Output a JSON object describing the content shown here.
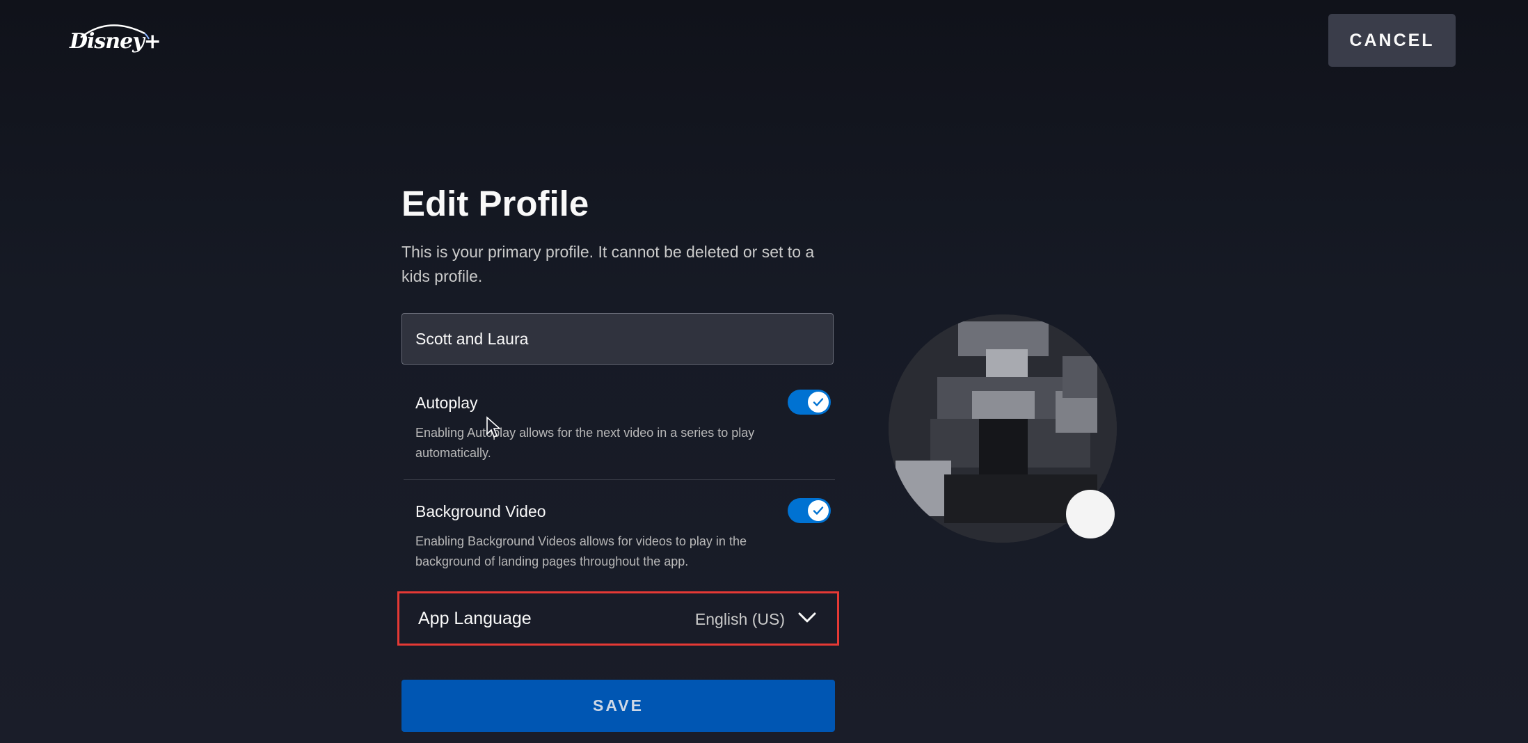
{
  "header": {
    "logo_text": "Disney+",
    "cancel_label": "CANCEL"
  },
  "page": {
    "title": "Edit Profile",
    "subtitle": "This is your primary profile. It cannot be deleted or set to a kids profile."
  },
  "profile_name": {
    "value": "Scott and Laura"
  },
  "settings": {
    "autoplay": {
      "label": "Autoplay",
      "description": "Enabling Autoplay allows for the next video in a series to play automatically.",
      "enabled": true
    },
    "background_video": {
      "label": "Background Video",
      "description": "Enabling Background Videos allows for videos to play in the background of landing pages throughout the app.",
      "enabled": true
    },
    "app_language": {
      "label": "App Language",
      "value": "English (US)"
    }
  },
  "save_label": "SAVE",
  "colors": {
    "toggle_on": "#0072d2",
    "save_button": "#0056b3",
    "highlight_border": "#e53935",
    "background": "#1a1d29"
  },
  "icons": {
    "logo": "disney-plus-logo",
    "toggle_check": "check-icon",
    "dropdown": "chevron-down-icon",
    "avatar_edit": "edit-avatar-icon"
  }
}
